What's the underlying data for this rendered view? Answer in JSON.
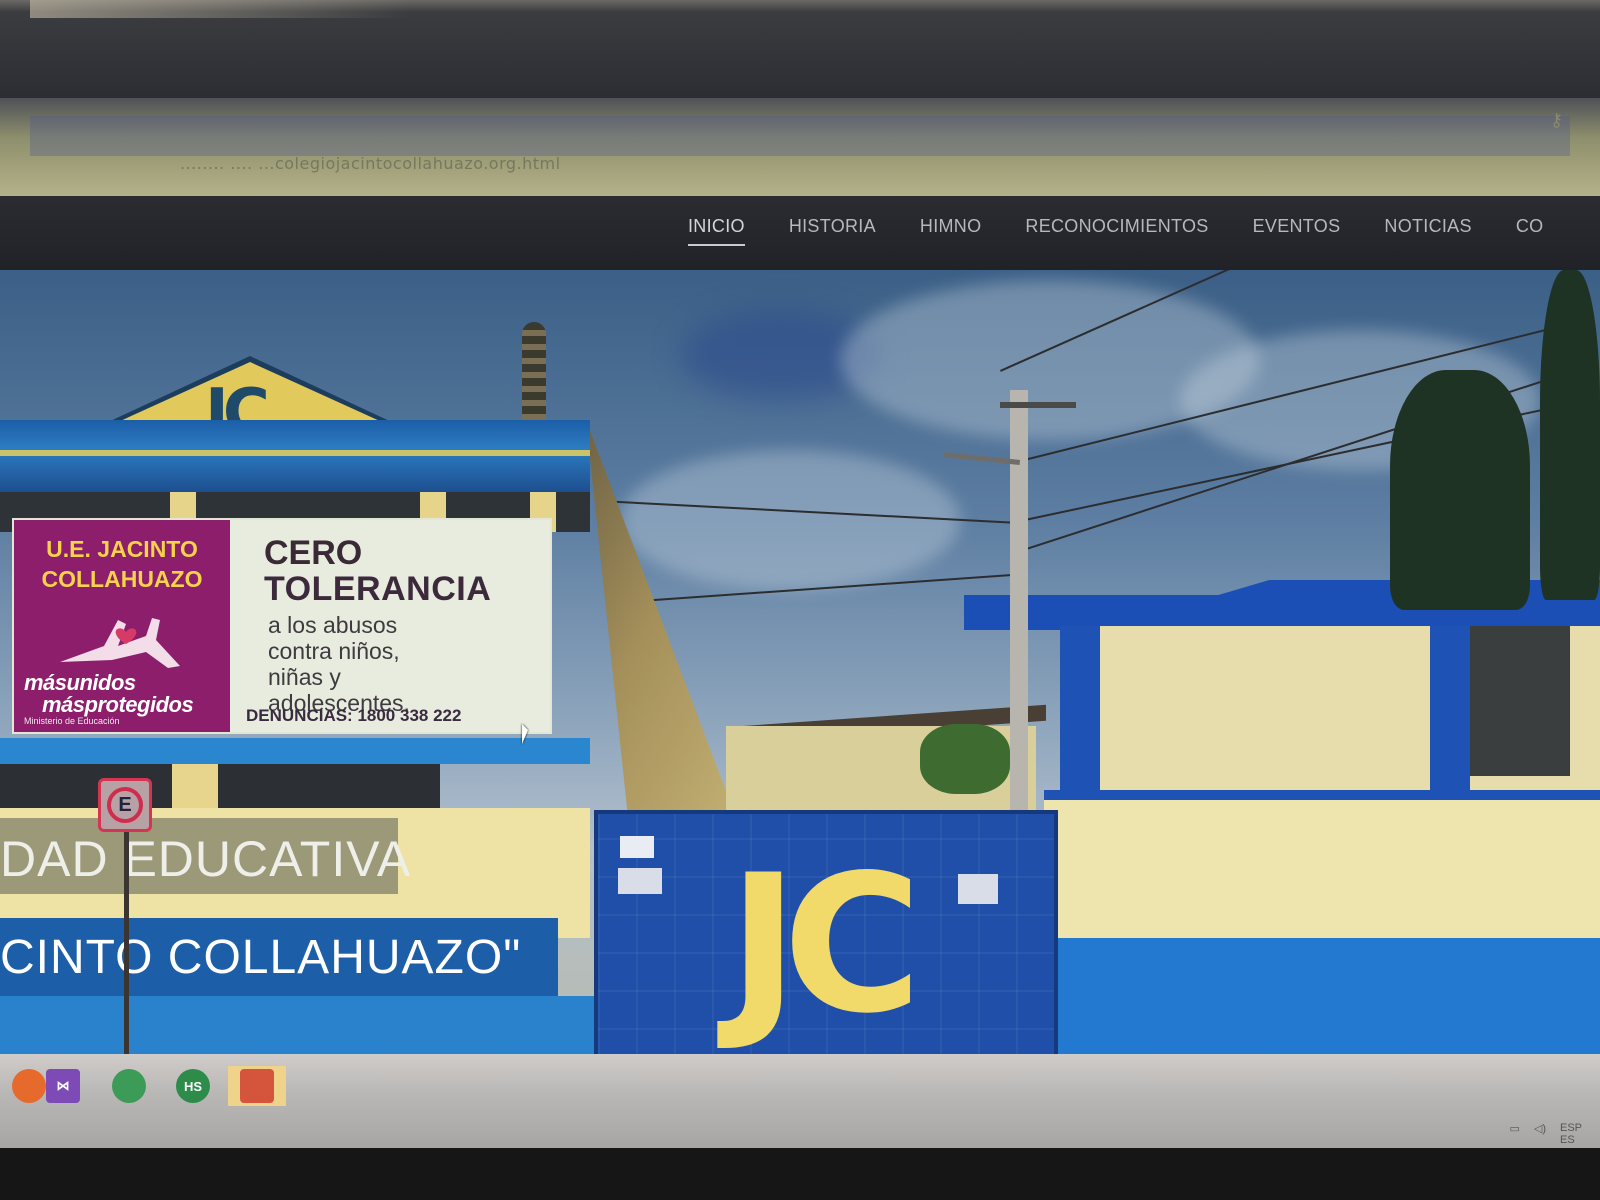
{
  "browser": {
    "url_text": "........ .... ...colegiojacintocollahuazo.org.html",
    "key_icon": "key-icon"
  },
  "nav": {
    "items": [
      {
        "label": "INICIO",
        "active": true
      },
      {
        "label": "HISTORIA",
        "active": false
      },
      {
        "label": "HIMNO",
        "active": false
      },
      {
        "label": "RECONOCIMIENTOS",
        "active": false
      },
      {
        "label": "EVENTOS",
        "active": false
      },
      {
        "label": "NOTICIAS",
        "active": false
      },
      {
        "label": "CO",
        "active": false
      }
    ]
  },
  "hero": {
    "gable_letters": "JC",
    "poster": {
      "school_line1": "U.E. JACINTO",
      "school_line2": "COLLAHUAZO",
      "slogan_line1": "másunidos",
      "slogan_line2": "másprotegidos",
      "ministry": "Ministerio de Educación",
      "headline_line1": "CERO",
      "headline_line2": "TOLERANCIA",
      "body_line1": "a los abusos",
      "body_line2": "contra niños,",
      "body_line3": "niñas y",
      "body_line4": "adolescentes.",
      "phone_label": "DENUNCIAS: 1800 338 222"
    },
    "banner_line1": "DAD EDUCATIVA",
    "banner_line2": "CINTO COLLAHUAZO\"",
    "gate_letters": "JC",
    "sign_glyph": "E"
  },
  "taskbar": {
    "icons": [
      {
        "name": "firefox-icon",
        "color": "#e66a2c",
        "glyph": ""
      },
      {
        "name": "visual-studio-icon",
        "color": "#7e4ab6",
        "glyph": "⋈"
      },
      {
        "name": "chrome-icon",
        "color": "#3c9b56",
        "glyph": ""
      },
      {
        "name": "hotspot-shield-icon",
        "color": "#2d8c4a",
        "glyph": "HS"
      },
      {
        "name": "security-shield-icon",
        "color": "#d4553b",
        "glyph": ""
      }
    ],
    "tray_lang": "ESP",
    "tray_sub": "ES"
  },
  "colors": {
    "school_blue": "#1f4fa8",
    "school_yellow": "#f1d96a",
    "poster_purple": "#8d1e6b",
    "nav_bg": "#1e2025"
  }
}
